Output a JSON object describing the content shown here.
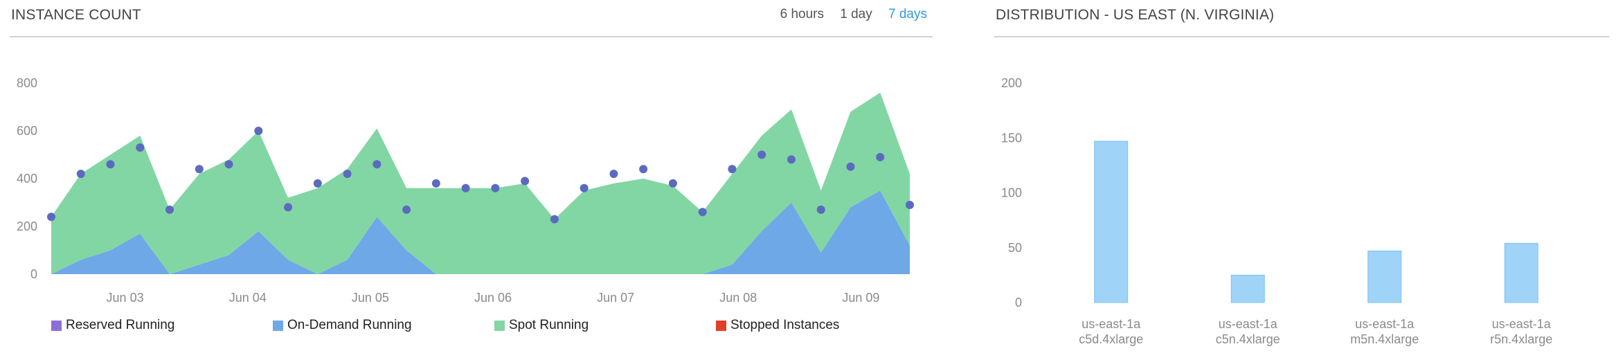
{
  "left_panel": {
    "title": "INSTANCE COUNT",
    "time_ranges": [
      {
        "label": "6 hours",
        "active": false
      },
      {
        "label": "1 day",
        "active": false
      },
      {
        "label": "7 days",
        "active": true
      }
    ]
  },
  "right_panel": {
    "title": "DISTRIBUTION - US EAST (N. VIRGINIA)"
  },
  "chart_data": [
    {
      "type": "area",
      "y_ticks": [
        0,
        200,
        400,
        600,
        800
      ],
      "ylim": [
        0,
        800
      ],
      "x_ticks": [
        "Jun 03",
        "Jun 04",
        "Jun 05",
        "Jun 06",
        "Jun 07",
        "Jun 08",
        "Jun 09"
      ],
      "x": [
        "Jun 02 12:00",
        "Jun 02 18:00",
        "Jun 03 00:00",
        "Jun 03 06:00",
        "Jun 03 12:00",
        "Jun 03 18:00",
        "Jun 04 00:00",
        "Jun 04 06:00",
        "Jun 04 12:00",
        "Jun 04 18:00",
        "Jun 05 00:00",
        "Jun 05 06:00",
        "Jun 05 12:00",
        "Jun 05 18:00",
        "Jun 06 00:00",
        "Jun 06 06:00",
        "Jun 06 12:00",
        "Jun 06 18:00",
        "Jun 07 00:00",
        "Jun 07 06:00",
        "Jun 07 12:00",
        "Jun 07 18:00",
        "Jun 08 00:00",
        "Jun 08 06:00",
        "Jun 08 12:00",
        "Jun 08 18:00",
        "Jun 09 00:00",
        "Jun 09 06:00",
        "Jun 09 12:00",
        "Jun 09 18:00"
      ],
      "legend_position": "bottom",
      "series": [
        {
          "name": "Reserved Running",
          "color": "#8b6fd9",
          "values": [
            0,
            0,
            0,
            0,
            0,
            0,
            0,
            0,
            0,
            0,
            0,
            0,
            0,
            0,
            0,
            0,
            0,
            0,
            0,
            0,
            0,
            0,
            0,
            0,
            0,
            0,
            0,
            0,
            0,
            0
          ]
        },
        {
          "name": "On-Demand Running",
          "color": "#6fa8e6",
          "values": [
            0,
            60,
            100,
            170,
            0,
            40,
            80,
            180,
            60,
            0,
            60,
            240,
            100,
            0,
            0,
            0,
            0,
            0,
            0,
            0,
            0,
            0,
            0,
            40,
            180,
            300,
            90,
            280,
            350,
            120
          ]
        },
        {
          "name": "Spot Running",
          "color": "#82d6a4",
          "values": [
            240,
            360,
            400,
            410,
            270,
            380,
            400,
            420,
            260,
            360,
            380,
            370,
            260,
            360,
            360,
            360,
            380,
            230,
            350,
            380,
            400,
            370,
            260,
            380,
            400,
            390,
            260,
            400,
            410,
            300
          ]
        },
        {
          "name": "Stopped Instances",
          "color": "#e04028",
          "values": [
            0,
            0,
            0,
            0,
            0,
            0,
            0,
            0,
            0,
            0,
            0,
            0,
            0,
            0,
            0,
            0,
            0,
            0,
            0,
            0,
            0,
            0,
            0,
            0,
            0,
            0,
            0,
            0,
            0,
            0
          ]
        }
      ],
      "total_points": [
        240,
        420,
        460,
        530,
        270,
        440,
        460,
        600,
        280,
        380,
        420,
        460,
        270,
        380,
        360,
        360,
        390,
        230,
        360,
        420,
        440,
        380,
        260,
        440,
        500,
        480,
        270,
        450,
        490,
        290
      ]
    },
    {
      "type": "bar",
      "categories": [
        [
          "us-east-1a",
          "c5d.4xlarge"
        ],
        [
          "us-east-1a",
          "c5n.4xlarge"
        ],
        [
          "us-east-1a",
          "m5n.4xlarge"
        ],
        [
          "us-east-1a",
          "r5n.4xlarge"
        ]
      ],
      "values": [
        147,
        25,
        47,
        54
      ],
      "y_ticks": [
        0,
        50,
        100,
        150,
        200
      ],
      "ylim": [
        0,
        200
      ],
      "bar_color": "#9fd3f7"
    }
  ]
}
